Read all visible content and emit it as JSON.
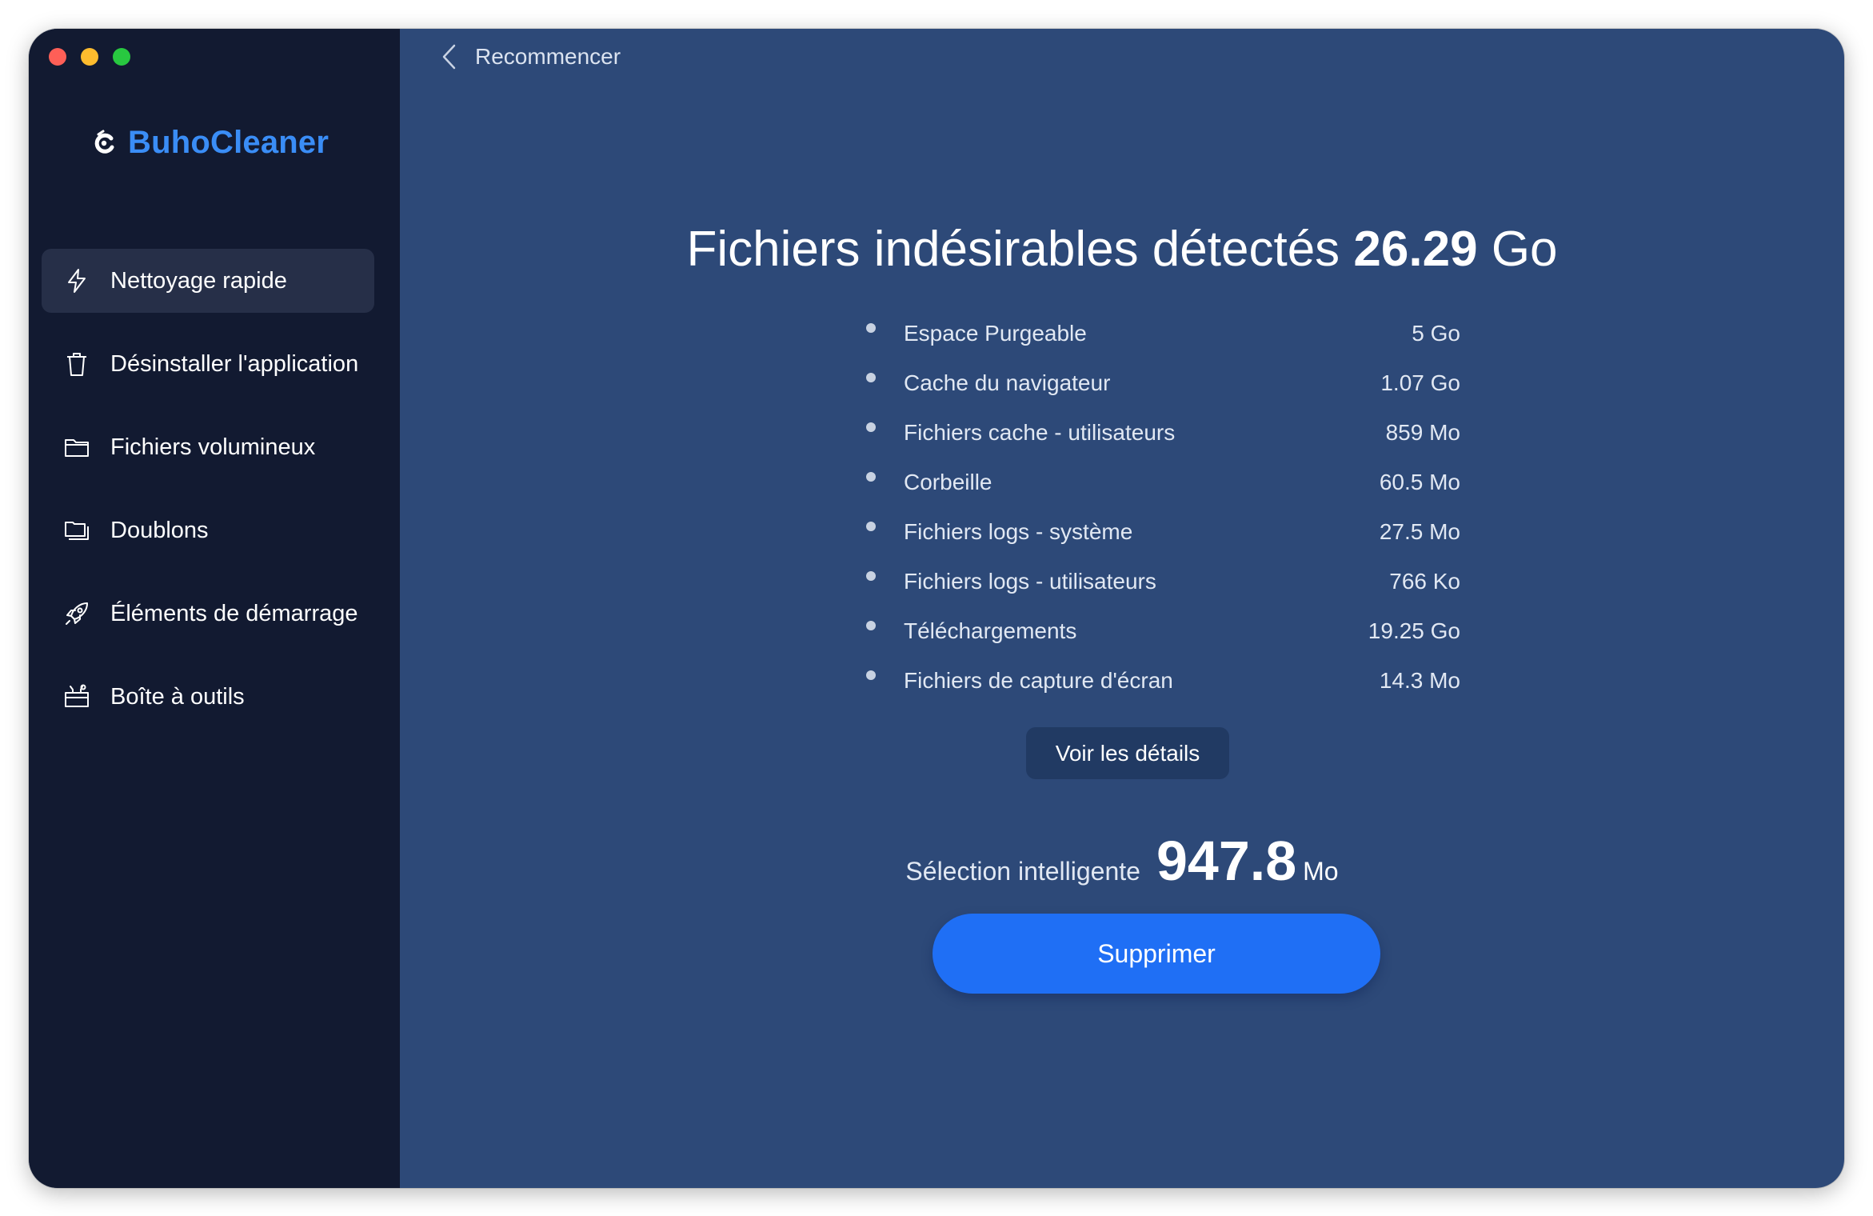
{
  "app": {
    "name": "BuhoCleaner",
    "accent": "#3a8df6"
  },
  "sidebar": {
    "items": [
      {
        "label": "Nettoyage rapide",
        "icon": "lightning-icon",
        "active": true
      },
      {
        "label": "Désinstaller l'application",
        "icon": "trash-icon",
        "active": false
      },
      {
        "label": "Fichiers volumineux",
        "icon": "folder-icon",
        "active": false
      },
      {
        "label": "Doublons",
        "icon": "duplicate-folder-icon",
        "active": false
      },
      {
        "label": "Éléments de démarrage",
        "icon": "rocket-icon",
        "active": false
      },
      {
        "label": "Boîte à outils",
        "icon": "toolbox-icon",
        "active": false
      }
    ]
  },
  "main": {
    "back_label": "Recommencer",
    "headline": {
      "prefix": "Fichiers indésirables détectés",
      "amount": "26.29",
      "unit": "Go"
    },
    "items": [
      {
        "name": "Espace Purgeable",
        "size": "5 Go"
      },
      {
        "name": "Cache du navigateur",
        "size": "1.07 Go"
      },
      {
        "name": "Fichiers cache - utilisateurs",
        "size": "859 Mo"
      },
      {
        "name": "Corbeille",
        "size": "60.5 Mo"
      },
      {
        "name": "Fichiers logs - système",
        "size": "27.5 Mo"
      },
      {
        "name": "Fichiers logs - utilisateurs",
        "size": "766 Ko"
      },
      {
        "name": "Téléchargements",
        "size": "19.25 Go"
      },
      {
        "name": "Fichiers de capture d'écran",
        "size": "14.3 Mo"
      }
    ],
    "details_button": "Voir les détails",
    "smart_selection": {
      "label": "Sélection intelligente",
      "value": "947.8",
      "unit": "Mo"
    },
    "delete_button": "Supprimer"
  },
  "colors": {
    "sidebar_bg": "#121a31",
    "main_bg": "#2d4978",
    "primary_button": "#1f6ff5"
  }
}
